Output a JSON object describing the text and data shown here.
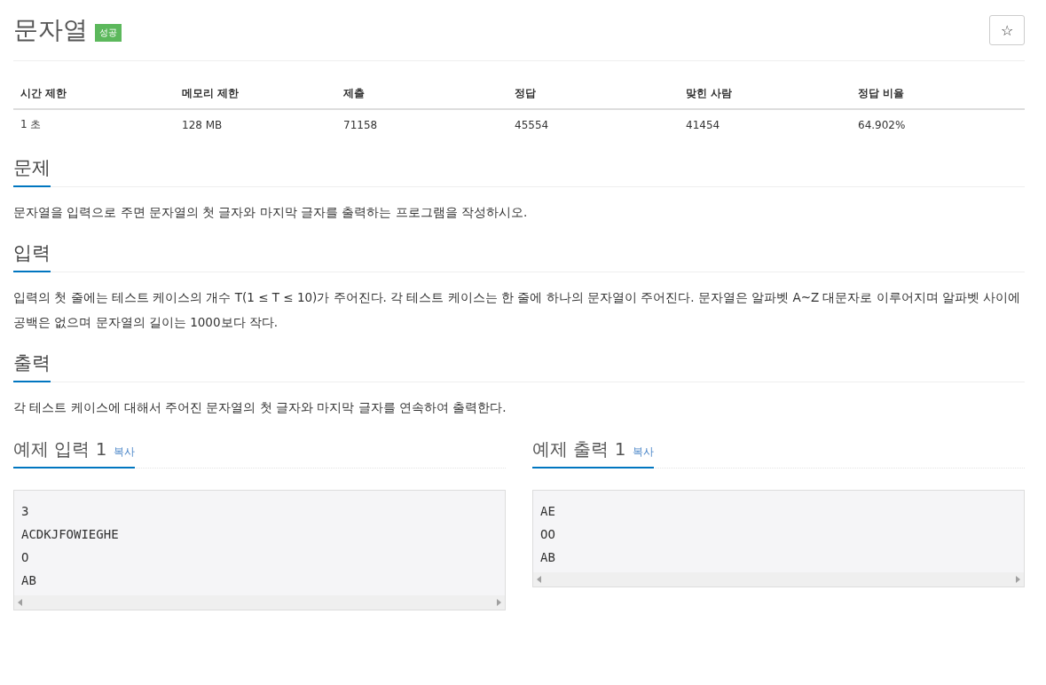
{
  "title": "문자열",
  "result_badge": "성공",
  "star_button": "☆",
  "info_table": {
    "columns": [
      "시간 제한",
      "메모리 제한",
      "제출",
      "정답",
      "맞힌 사람",
      "정답 비율"
    ],
    "rows": [
      [
        "1 초",
        "128 MB",
        "71158",
        "45554",
        "41454",
        "64.902%"
      ]
    ]
  },
  "sections": [
    {
      "heading": "문제",
      "paragraphs": [
        "문자열을 입력으로 주면 문자열의 첫 글자와 마지막 글자를 출력하는 프로그램을 작성하시오."
      ]
    },
    {
      "heading": "입력",
      "paragraphs": [
        "입력의 첫 줄에는 테스트 케이스의 개수 T(1 ≤ T ≤ 10)가 주어진다. 각 테스트 케이스는 한 줄에 하나의 문자열이 주어진다. 문자열은 알파벳 A~Z 대문자로 이루어지며 알파벳 사이에 공백은 없으며 문자열의 길이는 1000보다 작다."
      ]
    },
    {
      "heading": "출력",
      "paragraphs": [
        "각 테스트 케이스에 대해서 주어진 문자열의 첫 글자와 마지막 글자를 연속하여 출력한다."
      ]
    }
  ],
  "samples": [
    {
      "heading": "예제 입력 1",
      "copy_link": "복사",
      "lines": [
        "3",
        "ACDKJFOWIEGHE",
        "O",
        "AB"
      ]
    },
    {
      "heading": "예제 출력 1",
      "copy_link": "복사",
      "lines": [
        "AE",
        "OO",
        "AB"
      ]
    }
  ]
}
